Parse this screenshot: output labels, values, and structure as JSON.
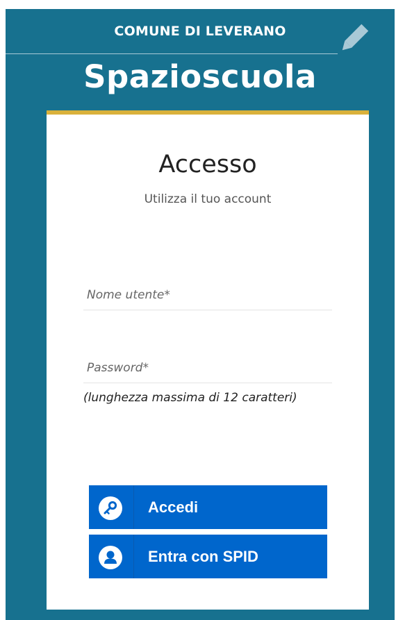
{
  "header": {
    "municipality": "COMUNE DI LEVERANO",
    "brand": "Spazioscuola"
  },
  "login": {
    "title": "Accesso",
    "subtitle": "Utilizza il tuo account",
    "username_placeholder": "Nome utente*",
    "password_placeholder": "Password*",
    "password_hint": "(lunghezza massima di 12 caratteri)",
    "login_button": "Accedi",
    "spid_button": "Entra con SPID"
  },
  "colors": {
    "background": "#17718f",
    "accent_bar": "#d9b13b",
    "button": "#0066cc"
  },
  "icons": {
    "header": "pencil-icon",
    "login_button": "key-icon",
    "spid_button": "user-icon"
  }
}
